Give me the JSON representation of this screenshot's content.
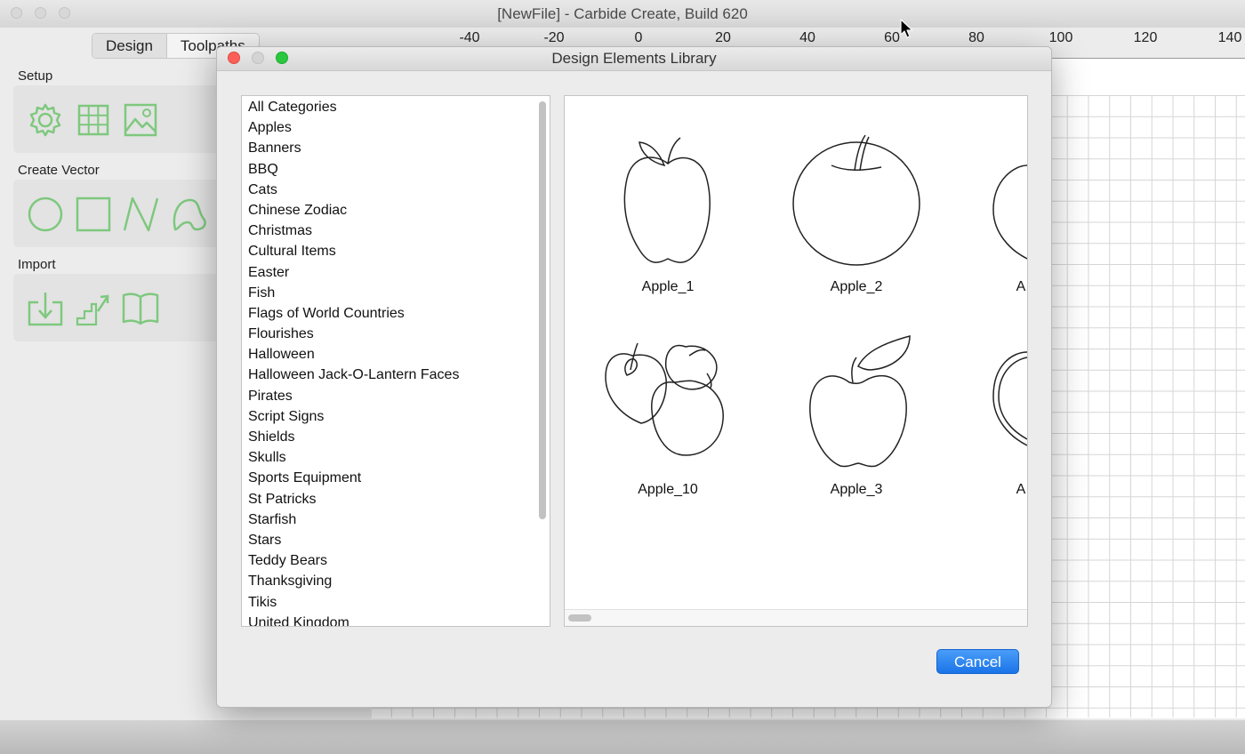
{
  "window": {
    "title": "[NewFile] - Carbide Create, Build 620"
  },
  "left_panel": {
    "tabs": [
      {
        "label": "Design"
      },
      {
        "label": "Toolpaths"
      }
    ],
    "sections": {
      "setup": {
        "label": "Setup",
        "icons": [
          "gear-icon",
          "grid-icon",
          "image-icon"
        ]
      },
      "create_vector": {
        "label": "Create Vector",
        "icons": [
          "circle-icon",
          "rectangle-icon",
          "polyline-icon",
          "curve-icon"
        ]
      },
      "import": {
        "label": "Import",
        "icons": [
          "import-icon",
          "stairs-icon",
          "book-icon"
        ]
      }
    }
  },
  "ruler": {
    "labels": [
      "-40",
      "-20",
      "0",
      "20",
      "40",
      "60",
      "80",
      "100",
      "120",
      "140"
    ]
  },
  "dialog": {
    "title": "Design Elements Library",
    "categories": [
      "All Categories",
      "Apples",
      "Banners",
      "BBQ",
      "Cats",
      "Chinese Zodiac",
      "Christmas",
      "Cultural Items",
      "Easter",
      "Fish",
      "Flags of World Countries",
      "Flourishes",
      "Halloween",
      "Halloween Jack-O-Lantern Faces",
      "Pirates",
      "Script Signs",
      "Shields",
      "Skulls",
      "Sports Equipment",
      "St Patricks",
      "Starfish",
      "Stars",
      "Teddy Bears",
      "Thanksgiving",
      "Tikis",
      "United Kingdom"
    ],
    "elements": [
      {
        "label": "Apple_1"
      },
      {
        "label": "Apple_2"
      },
      {
        "label": "A"
      },
      {
        "label": "Apple_10"
      },
      {
        "label": "Apple_3"
      },
      {
        "label": "A"
      }
    ],
    "cancel_label": "Cancel"
  },
  "colors": {
    "tool_icon": "#7ec87e",
    "cancel_button": "#1a74e8",
    "close_button": "#fc5f57",
    "zoom_button": "#2ac840"
  }
}
